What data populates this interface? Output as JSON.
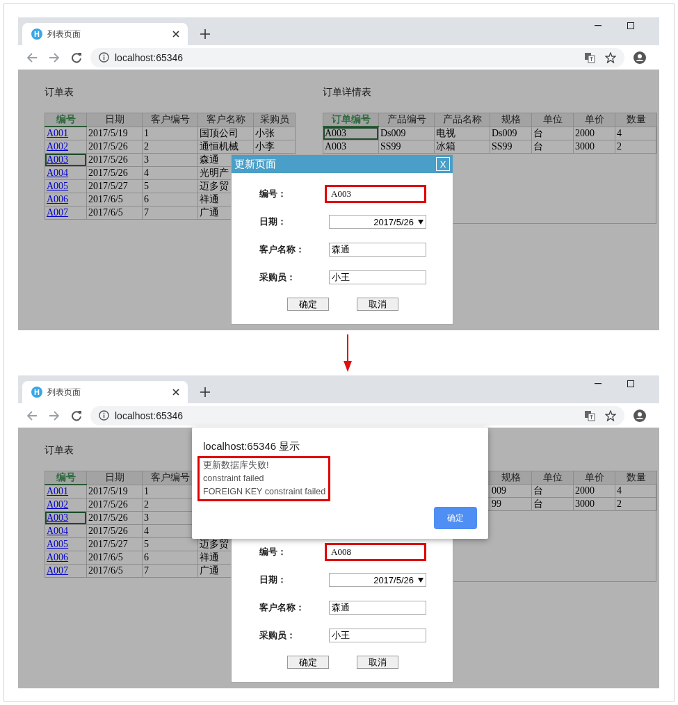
{
  "screens": [
    {
      "tab": {
        "title": "列表页面",
        "icon_letter": "H"
      },
      "address": "localhost:65346",
      "orders": {
        "title": "订单表",
        "columns": [
          {
            "label": "编号",
            "active": true
          },
          {
            "label": "日期",
            "active": false
          },
          {
            "label": "客户编号",
            "active": false
          },
          {
            "label": "客户名称",
            "active": false
          },
          {
            "label": "采购员",
            "active": false
          }
        ],
        "rows": [
          {
            "selected": false,
            "cells": [
              "A001",
              "2017/5/19",
              "1",
              "国顶公司",
              "小张"
            ]
          },
          {
            "selected": false,
            "cells": [
              "A002",
              "2017/5/26",
              "2",
              "通恒机械",
              "小李"
            ]
          },
          {
            "selected": true,
            "cells": [
              "A003",
              "2017/5/26",
              "3",
              "森通",
              null
            ]
          },
          {
            "selected": false,
            "cells": [
              "A004",
              "2017/5/26",
              "4",
              "光明产",
              null
            ]
          },
          {
            "selected": false,
            "cells": [
              "A005",
              "2017/5/27",
              "5",
              "迈多贸",
              null
            ]
          },
          {
            "selected": false,
            "cells": [
              "A006",
              "2017/6/5",
              "6",
              "祥通",
              null
            ]
          },
          {
            "selected": false,
            "cells": [
              "A007",
              "2017/6/5",
              "7",
              "广通",
              null
            ]
          }
        ]
      },
      "details": {
        "title": "订单详情表",
        "columns": [
          {
            "label": "订单编号",
            "active": true
          },
          {
            "label": "产品编号",
            "active": false
          },
          {
            "label": "产品名称",
            "active": false
          },
          {
            "label": "规格",
            "active": false
          },
          {
            "label": "单位",
            "active": false
          },
          {
            "label": "单价",
            "active": false
          },
          {
            "label": "数量",
            "active": false
          }
        ],
        "rows": [
          {
            "selected": true,
            "cells": [
              "A003",
              "Ds009",
              "电视",
              "Ds009",
              "台",
              "2000",
              "4"
            ]
          },
          {
            "selected": false,
            "cells": [
              "A003",
              "SS99",
              "冰箱",
              "SS99",
              "台",
              "3000",
              "2"
            ]
          }
        ]
      },
      "dialog": {
        "title": "更新页面",
        "close_label": "X",
        "fields": [
          {
            "label": "编号：",
            "kind": "text",
            "value": "A003",
            "highlighted": true
          },
          {
            "label": "日期：",
            "kind": "select",
            "value": "2017/5/26",
            "highlighted": false
          },
          {
            "label": "客户名称：",
            "kind": "text",
            "value": "森通",
            "highlighted": false
          },
          {
            "label": "采购员：",
            "kind": "text",
            "value": "小王",
            "highlighted": false
          }
        ],
        "buttons": [
          "确定",
          "取消"
        ]
      }
    },
    {
      "tab": {
        "title": "列表页面",
        "icon_letter": "H"
      },
      "address": "localhost:65346",
      "orders": {
        "title": "订单表",
        "columns": [
          {
            "label": "编号",
            "active": true
          },
          {
            "label": "日期",
            "active": false
          },
          {
            "label": "客户编号",
            "active": false
          },
          null,
          null
        ],
        "rows": [
          {
            "selected": false,
            "cells": [
              "A001",
              "2017/5/19",
              "1",
              null,
              null
            ]
          },
          {
            "selected": false,
            "cells": [
              "A002",
              "2017/5/26",
              "2",
              null,
              null
            ]
          },
          {
            "selected": true,
            "cells": [
              "A003",
              "2017/5/26",
              "3",
              null,
              null
            ]
          },
          {
            "selected": false,
            "cells": [
              "A004",
              "2017/5/26",
              "4",
              null,
              null
            ]
          },
          {
            "selected": false,
            "cells": [
              "A005",
              "2017/5/27",
              "5",
              "迈多贸",
              null
            ]
          },
          {
            "selected": false,
            "cells": [
              "A006",
              "2017/6/5",
              "6",
              "祥通",
              null
            ]
          },
          {
            "selected": false,
            "cells": [
              "A007",
              "2017/6/5",
              "7",
              "广通",
              null
            ]
          }
        ]
      },
      "details": {
        "columns": [
          null,
          null,
          null,
          {
            "label": "规格",
            "active": false
          },
          {
            "label": "单位",
            "active": false
          },
          {
            "label": "单价",
            "active": false
          },
          {
            "label": "数量",
            "active": false
          }
        ],
        "rows": [
          {
            "cells": [
              null,
              null,
              null,
              "009",
              "台",
              "2000",
              "4"
            ]
          },
          {
            "cells": [
              null,
              null,
              null,
              "99",
              "台",
              "3000",
              "2"
            ]
          }
        ]
      },
      "dialog": {
        "fields": [
          {
            "label": "编号：",
            "kind": "text",
            "value": "A008",
            "highlighted": true
          },
          {
            "label": "日期：",
            "kind": "select",
            "value": "2017/5/26",
            "highlighted": false
          },
          {
            "label": "客户名称：",
            "kind": "text",
            "value": "森通",
            "highlighted": false
          },
          {
            "label": "采购员：",
            "kind": "text",
            "value": "小王",
            "highlighted": false
          }
        ],
        "buttons": [
          "确定",
          "取消"
        ]
      },
      "alert": {
        "title": "localhost:65346 显示",
        "messages": [
          "更新数据库失败!",
          "constraint failed",
          "FOREIGN KEY constraint failed"
        ],
        "highlighted": true,
        "button": "确定"
      }
    }
  ]
}
